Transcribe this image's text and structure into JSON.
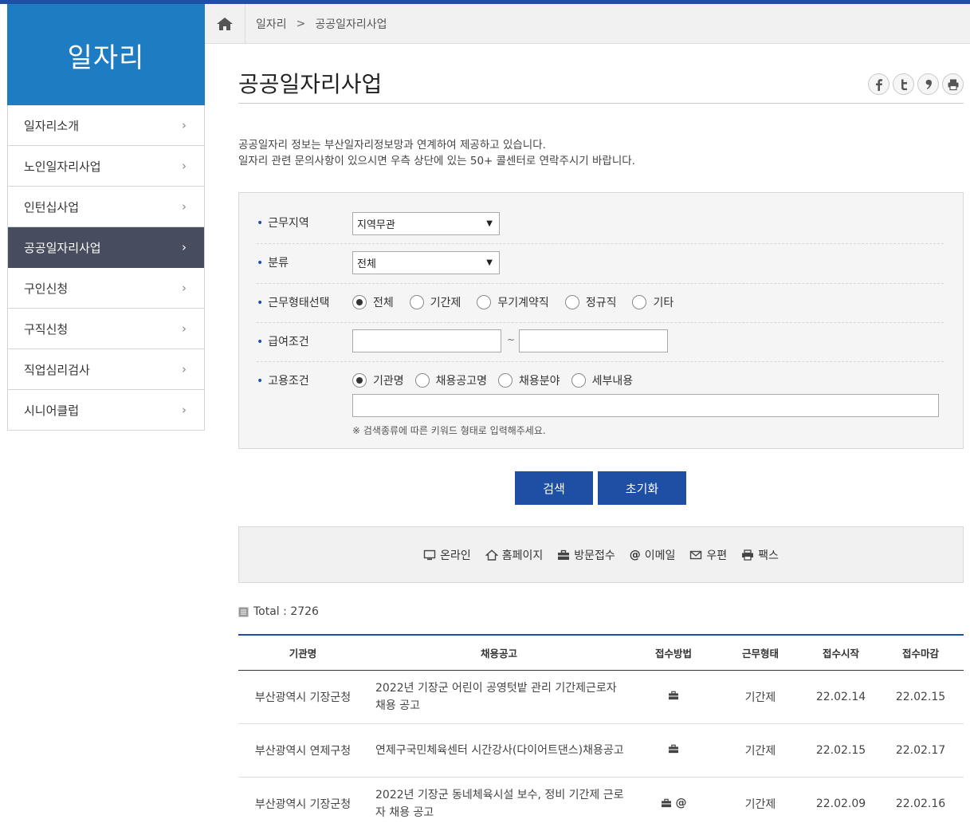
{
  "sidebar": {
    "title": "일자리",
    "items": [
      {
        "label": "일자리소개"
      },
      {
        "label": "노인일자리사업"
      },
      {
        "label": "인턴십사업"
      },
      {
        "label": "공공일자리사업"
      },
      {
        "label": "구인신청"
      },
      {
        "label": "구직신청"
      },
      {
        "label": "직업심리검사"
      },
      {
        "label": "시니어클럽"
      }
    ],
    "active_index": 3
  },
  "breadcrumb": {
    "level1": "일자리",
    "separator": ">",
    "level2": "공공일자리사업"
  },
  "page": {
    "title": "공공일자리사업",
    "intro_line1": "공공일자리 정보는 부산일자리정보망과 연계하여 제공하고 있습니다.",
    "intro_line2": "일자리 관련 문의사항이 있으시면 우측 상단에 있는 50+ 콜센터로 연락주시기 바랍니다."
  },
  "share": [
    "facebook-icon",
    "twitter-icon",
    "kakao-icon",
    "print-icon"
  ],
  "search": {
    "region_label": "근무지역",
    "region_value": "지역무관",
    "category_label": "분류",
    "category_value": "전체",
    "worktype_label": "근무형태선택",
    "worktype_options": [
      "전체",
      "기간제",
      "무기계약직",
      "정규직",
      "기타"
    ],
    "worktype_selected": 0,
    "salary_label": "급여조건",
    "salary_tilde": "~",
    "employ_label": "고용조건",
    "employ_options": [
      "기관명",
      "채용공고명",
      "채용분야",
      "세부내용"
    ],
    "employ_selected": 0,
    "hint": "※ 검색종류에 따른 키워드 형태로 입력해주세요."
  },
  "buttons": {
    "search": "검색",
    "reset": "초기화"
  },
  "legend": {
    "online": "온라인",
    "homepage": "홈페이지",
    "visit": "방문접수",
    "email": "이메일",
    "post": "우편",
    "fax": "팩스"
  },
  "total": {
    "label": "Total : 2726"
  },
  "table": {
    "headers": [
      "기관명",
      "채용공고",
      "접수방법",
      "근무형태",
      "접수시작",
      "접수마감"
    ],
    "rows": [
      {
        "org": "부산광역시 기장군청",
        "title": "2022년 기장군 어린이 공영텃밭 관리 기간제근로자 채용 공고",
        "methods": [
          "visit"
        ],
        "type": "기간제",
        "start": "22.02.14",
        "end": "22.02.15"
      },
      {
        "org": "부산광역시 연제구청",
        "title": "연제구국민체육센터 시간강사(다이어트댄스)채용공고",
        "methods": [
          "visit"
        ],
        "type": "기간제",
        "start": "22.02.15",
        "end": "22.02.17"
      },
      {
        "org": "부산광역시 기장군청",
        "title": "2022년 기장군 동네체육시설 보수, 정비 기간제 근로자 채용 공고",
        "methods": [
          "visit",
          "email"
        ],
        "type": "기간제",
        "start": "22.02.09",
        "end": "22.02.16"
      }
    ]
  },
  "colors": {
    "primary": "#1f4ea5",
    "sidebar_head": "#1e7cc2",
    "sidebar_active": "#474d5e"
  }
}
